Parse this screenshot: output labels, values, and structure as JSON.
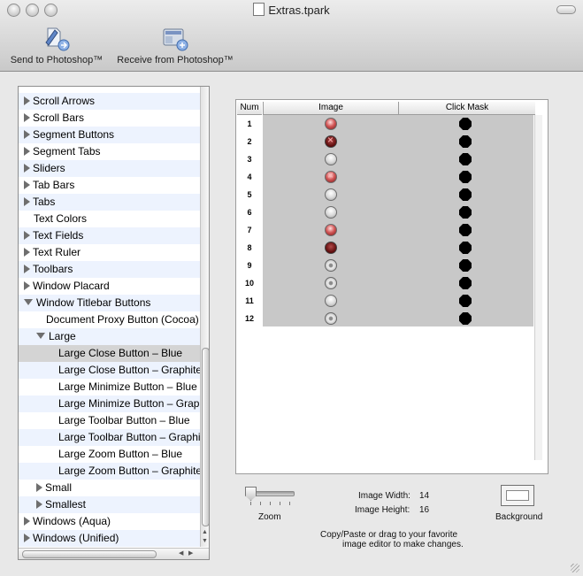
{
  "window": {
    "title": "Extras.tpark"
  },
  "toolbar": {
    "send_label": "Send to Photoshop™",
    "receive_label": "Receive from Photoshop™"
  },
  "sidebar": {
    "items": [
      {
        "label": "Scroll Arrows",
        "indent": 0,
        "state": "closed"
      },
      {
        "label": "Scroll Bars",
        "indent": 0,
        "state": "closed"
      },
      {
        "label": "Segment Buttons",
        "indent": 0,
        "state": "closed"
      },
      {
        "label": "Segment Tabs",
        "indent": 0,
        "state": "closed"
      },
      {
        "label": "Sliders",
        "indent": 0,
        "state": "closed"
      },
      {
        "label": "Tab Bars",
        "indent": 0,
        "state": "closed"
      },
      {
        "label": "Tabs",
        "indent": 0,
        "state": "closed"
      },
      {
        "label": "Text Colors",
        "indent": 0,
        "state": "leaf"
      },
      {
        "label": "Text Fields",
        "indent": 0,
        "state": "closed"
      },
      {
        "label": "Text Ruler",
        "indent": 0,
        "state": "closed"
      },
      {
        "label": "Toolbars",
        "indent": 0,
        "state": "closed"
      },
      {
        "label": "Window Placard",
        "indent": 0,
        "state": "closed"
      },
      {
        "label": "Window Titlebar Buttons",
        "indent": 0,
        "state": "open"
      },
      {
        "label": "Document Proxy Button (Cocoa)",
        "indent": 1,
        "state": "leaf"
      },
      {
        "label": "Large",
        "indent": 1,
        "state": "open"
      },
      {
        "label": "Large Close Button – Blue",
        "indent": 2,
        "state": "leaf",
        "selected": true
      },
      {
        "label": "Large Close Button – Graphite",
        "indent": 2,
        "state": "leaf"
      },
      {
        "label": "Large Minimize Button – Blue",
        "indent": 2,
        "state": "leaf"
      },
      {
        "label": "Large Minimize Button – Graphite",
        "indent": 2,
        "state": "leaf"
      },
      {
        "label": "Large Toolbar Button – Blue",
        "indent": 2,
        "state": "leaf"
      },
      {
        "label": "Large Toolbar Button – Graphite",
        "indent": 2,
        "state": "leaf"
      },
      {
        "label": "Large Zoom Button – Blue",
        "indent": 2,
        "state": "leaf"
      },
      {
        "label": "Large Zoom Button – Graphite",
        "indent": 2,
        "state": "leaf"
      },
      {
        "label": "Small",
        "indent": 1,
        "state": "closed"
      },
      {
        "label": "Smallest",
        "indent": 1,
        "state": "closed"
      },
      {
        "label": "Windows (Aqua)",
        "indent": 0,
        "state": "closed"
      },
      {
        "label": "Windows (Unified)",
        "indent": 0,
        "state": "closed"
      }
    ]
  },
  "table": {
    "headers": {
      "num": "Num",
      "image": "Image",
      "mask": "Click Mask"
    },
    "rows": [
      {
        "num": "1",
        "style": "red"
      },
      {
        "num": "2",
        "style": "dark-x"
      },
      {
        "num": "3",
        "style": "gray"
      },
      {
        "num": "4",
        "style": "red-x"
      },
      {
        "num": "5",
        "style": "gray"
      },
      {
        "num": "6",
        "style": "gray"
      },
      {
        "num": "7",
        "style": "red"
      },
      {
        "num": "8",
        "style": "dark"
      },
      {
        "num": "9",
        "style": "ring"
      },
      {
        "num": "10",
        "style": "ring"
      },
      {
        "num": "11",
        "style": "gray"
      },
      {
        "num": "12",
        "style": "ring"
      }
    ]
  },
  "info": {
    "zoom_label": "Zoom",
    "width_label": "Image Width:",
    "width_value": "14",
    "height_label": "Image Height:",
    "height_value": "16",
    "background_label": "Background",
    "hint_line1": "Copy/Paste or drag to your favorite",
    "hint_line2": "image editor to make changes."
  },
  "zoom": {
    "level": 0,
    "min": 0,
    "max": 5
  }
}
